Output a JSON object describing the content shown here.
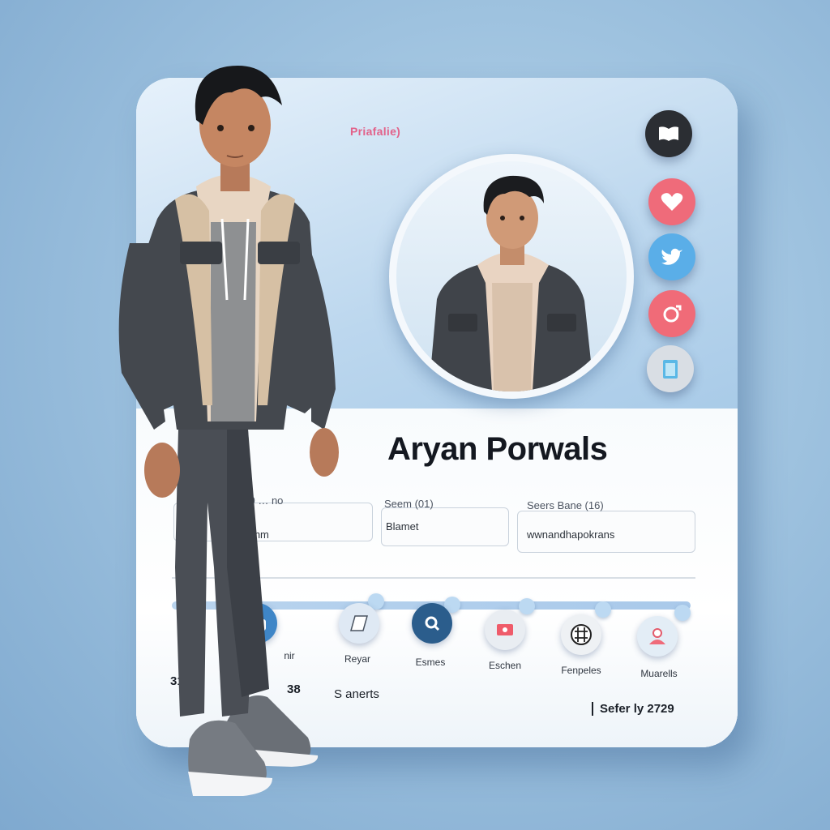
{
  "card": {
    "header_label": "Priafalie)",
    "name": "Aryan Porwals"
  },
  "social_icons": [
    "book-icon",
    "heart-icon",
    "twitter-bird-icon",
    "ring-icon",
    "door-icon"
  ],
  "fields": [
    {
      "label": "1) (0 … no",
      "value": "Pormm"
    },
    {
      "label": "Seem (01)",
      "value": "Blamet"
    },
    {
      "label": "Seers Bane (16)",
      "value": "wwnandhapokrans"
    }
  ],
  "timeline": [
    {
      "icon": "camera-icon",
      "label": "nir"
    },
    {
      "icon": "folder-icon",
      "label": "Reyar"
    },
    {
      "icon": "search-icon",
      "label": "Esmes"
    },
    {
      "icon": "photo-icon",
      "label": "Eschen"
    },
    {
      "icon": "grid-icon",
      "label": "Fenpeles"
    },
    {
      "icon": "user-icon",
      "label": "Muarells"
    }
  ],
  "footer": {
    "left": "31",
    "mid_num": "38",
    "mid_text": "S anerts",
    "right": "Sefer ly 2729"
  },
  "colors": {
    "accent": "#e2628a",
    "twitter": "#5aaee8",
    "heart": "#ef6b7a",
    "dark_icon": "#2b2e33"
  }
}
